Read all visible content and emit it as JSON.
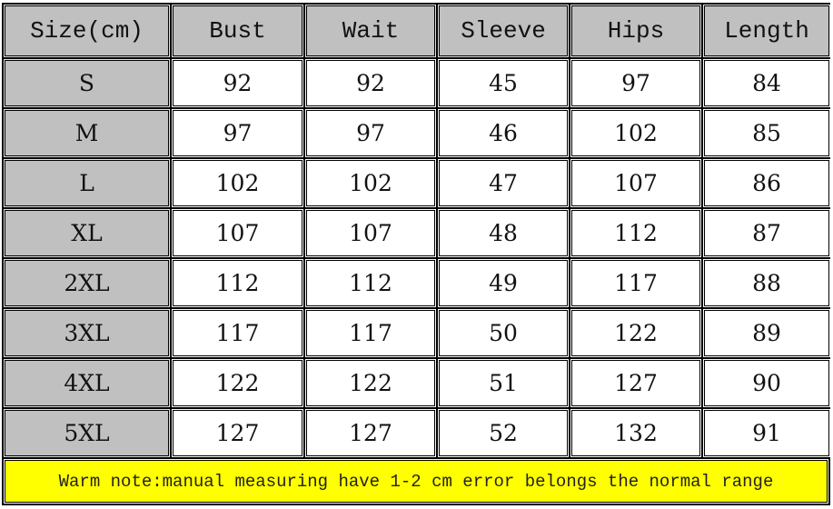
{
  "table": {
    "headers": [
      "Size(cm)",
      "Bust",
      "Wait",
      "Sleeve",
      "Hips",
      "Length"
    ],
    "rows": [
      [
        "S",
        "92",
        "92",
        "45",
        "97",
        "84"
      ],
      [
        "M",
        "97",
        "97",
        "46",
        "102",
        "85"
      ],
      [
        "L",
        "102",
        "102",
        "47",
        "107",
        "86"
      ],
      [
        "XL",
        "107",
        "107",
        "48",
        "112",
        "87"
      ],
      [
        "2XL",
        "112",
        "112",
        "49",
        "117",
        "88"
      ],
      [
        "3XL",
        "117",
        "117",
        "50",
        "122",
        "89"
      ],
      [
        "4XL",
        "122",
        "122",
        "51",
        "127",
        "90"
      ],
      [
        "5XL",
        "127",
        "127",
        "52",
        "132",
        "91"
      ]
    ]
  },
  "note": "Warm note:manual measuring have 1-2 cm error belongs the normal range",
  "colors": {
    "header_bg": "#c0c0c0",
    "size_col_bg": "#c0c0c0",
    "data_bg": "#ffffff",
    "note_bg": "#ffff00",
    "border": "#000000"
  }
}
